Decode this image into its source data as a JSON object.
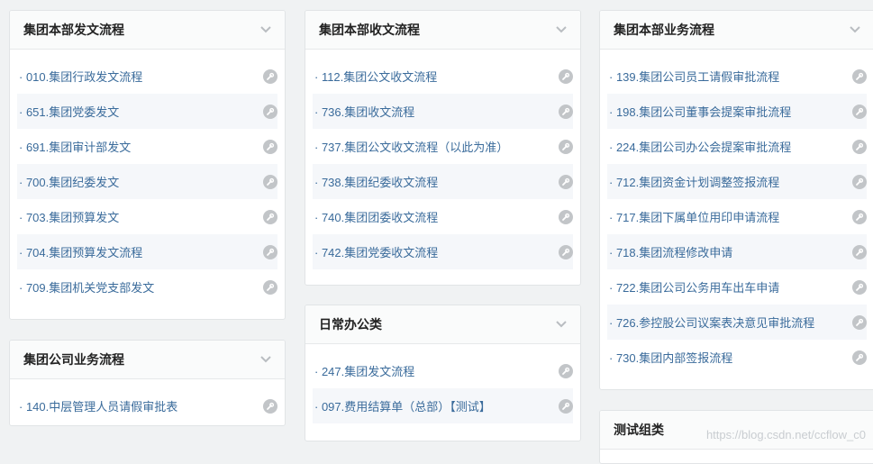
{
  "panels": {
    "hq_dispatch": {
      "title": "集团本部发文流程",
      "items": [
        "010.集团行政发文流程",
        "651.集团党委发文",
        "691.集团审计部发文",
        "700.集团纪委发文",
        "703.集团预算发文",
        "704.集团预算发文流程",
        "709.集团机关党支部发文"
      ]
    },
    "group_business": {
      "title": "集团公司业务流程",
      "items": [
        "140.中层管理人员请假审批表"
      ]
    },
    "hq_receive": {
      "title": "集团本部收文流程",
      "items": [
        "112.集团公文收文流程",
        "736.集团收文流程",
        "737.集团公文收文流程（以此为准）",
        "738.集团纪委收文流程",
        "740.集团团委收文流程",
        "742.集团党委收文流程"
      ]
    },
    "daily_office": {
      "title": "日常办公类",
      "items": [
        "247.集团发文流程",
        "097.费用结算单（总部）【测试】"
      ]
    },
    "hq_business": {
      "title": "集团本部业务流程",
      "items": [
        "139.集团公司员工请假审批流程",
        "198.集团公司董事会提案审批流程",
        "224.集团公司办公会提案审批流程",
        "712.集团资金计划调整签报流程",
        "717.集团下属单位用印申请流程",
        "718.集团流程修改申请",
        "722.集团公司公务用车出车申请",
        "726.参控股公司议案表决意见审批流程",
        "730.集团内部签报流程"
      ]
    },
    "test_group": {
      "title": "测试组类",
      "items": []
    }
  },
  "watermark": "https://blog.csdn.net/ccflow_c0",
  "icons": {
    "item_action": "wrench-icon",
    "collapse": "chevron-down-icon"
  },
  "colors": {
    "link": "#3a6b9b",
    "icon": "#c2c5c8",
    "background": "#f0f2f3"
  }
}
